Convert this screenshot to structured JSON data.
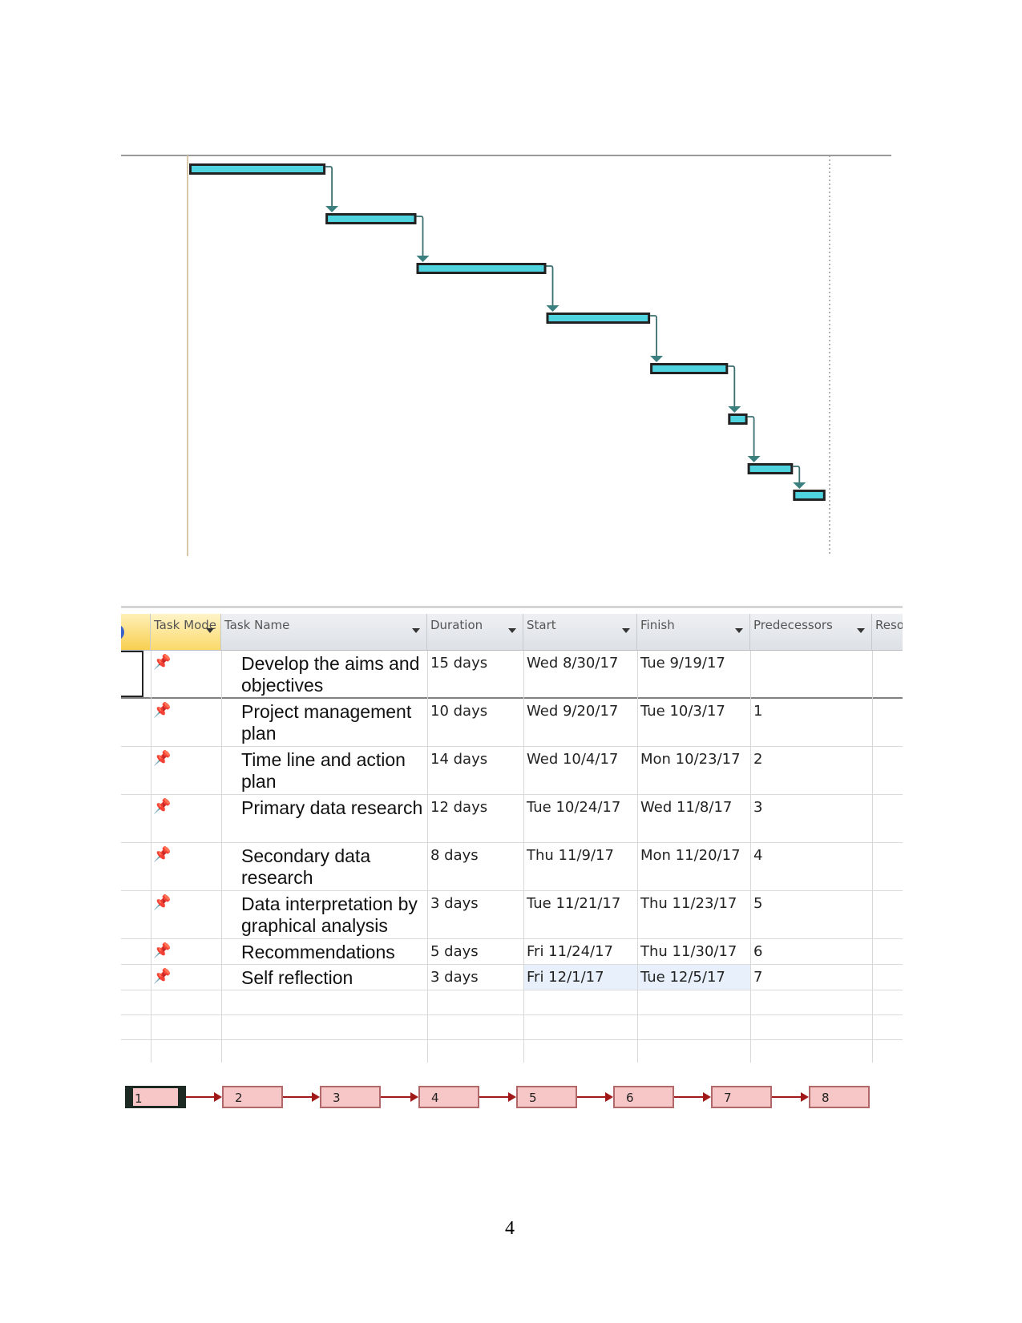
{
  "chart_data": {
    "type": "gantt",
    "bar_color": "#4fd3de",
    "tasks": [
      {
        "id": 1,
        "start": "8/30/17",
        "finish": "9/19/17"
      },
      {
        "id": 2,
        "start": "9/20/17",
        "finish": "10/3/17"
      },
      {
        "id": 3,
        "start": "10/4/17",
        "finish": "10/23/17"
      },
      {
        "id": 4,
        "start": "10/24/17",
        "finish": "11/8/17"
      },
      {
        "id": 5,
        "start": "11/9/17",
        "finish": "11/20/17"
      },
      {
        "id": 6,
        "start": "11/21/17",
        "finish": "11/23/17"
      },
      {
        "id": 7,
        "start": "11/24/17",
        "finish": "11/30/17"
      },
      {
        "id": 8,
        "start": "12/1/17",
        "finish": "12/5/17"
      }
    ]
  },
  "table": {
    "headers": {
      "info": "i",
      "mode": "Task Mode",
      "name": "Task Name",
      "duration": "Duration",
      "start": "Start",
      "finish": "Finish",
      "predecessors": "Predecessors",
      "resources": "Reso"
    },
    "rows": [
      {
        "name": "Develop the aims and objectives",
        "duration": "15 days",
        "start": "Wed 8/30/17",
        "finish": "Tue 9/19/17",
        "predecessors": ""
      },
      {
        "name": "Project management plan",
        "duration": "10 days",
        "start": "Wed 9/20/17",
        "finish": "Tue 10/3/17",
        "predecessors": "1"
      },
      {
        "name": "Time line and action plan",
        "duration": "14 days",
        "start": "Wed 10/4/17",
        "finish": "Mon 10/23/17",
        "predecessors": "2"
      },
      {
        "name": "Primary data research",
        "duration": "12 days",
        "start": "Tue 10/24/17",
        "finish": "Wed 11/8/17",
        "predecessors": "3"
      },
      {
        "name": "Secondary data research",
        "duration": "8 days",
        "start": "Thu 11/9/17",
        "finish": "Mon 11/20/17",
        "predecessors": "4"
      },
      {
        "name": "Data interpretation by graphical analysis",
        "duration": "3 days",
        "start": "Tue 11/21/17",
        "finish": "Thu 11/23/17",
        "predecessors": "5"
      },
      {
        "name": "Recommendations",
        "duration": "5 days",
        "start": "Fri 11/24/17",
        "finish": "Thu 11/30/17",
        "predecessors": "6"
      },
      {
        "name": "Self reflection",
        "duration": "3 days",
        "start": "Fri 12/1/17",
        "finish": "Tue 12/5/17",
        "predecessors": "7"
      }
    ]
  },
  "network": {
    "nodes": [
      "1",
      "2",
      "3",
      "4",
      "5",
      "6",
      "7",
      "8"
    ],
    "color": "#f7c6c6"
  },
  "page_number": "4"
}
